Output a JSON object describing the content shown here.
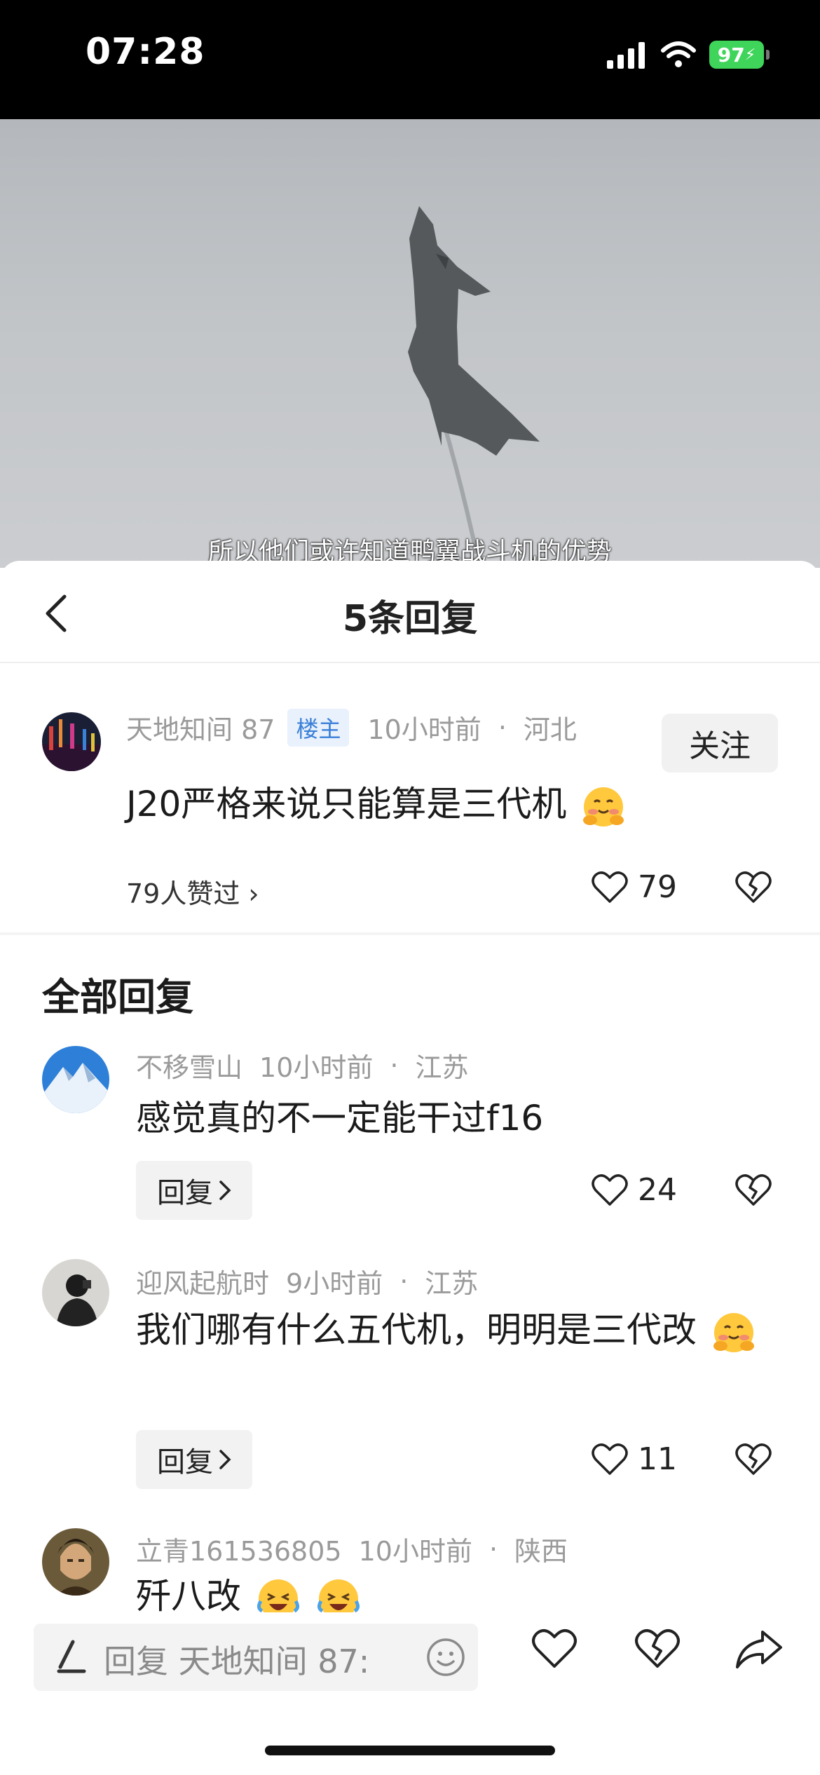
{
  "status_bar": {
    "time": "07:28",
    "battery": "97"
  },
  "video": {
    "subtitle": "所以他们或许知道鸭翼战斗机的优势"
  },
  "sheet": {
    "title": "5条回复",
    "op": {
      "username": "天地知间 87",
      "badge": "楼主",
      "time": "10小时前",
      "location": "河北",
      "follow_label": "关注",
      "text": "J20严格来说只能算是三代机",
      "likers": "79人赞过 ›",
      "like_count": "79"
    },
    "section_title": "全部回复",
    "replies": [
      {
        "username": "不移雪山",
        "time": "10小时前",
        "location": "江苏",
        "text": "感觉真的不一定能干过f16",
        "reply_label": "回复",
        "like_count": "24"
      },
      {
        "username": "迎风起航时",
        "time": "9小时前",
        "location": "江苏",
        "text": "我们哪有什么五代机，明明是三代改",
        "reply_label": "回复",
        "like_count": "11"
      },
      {
        "username": "立青161536805",
        "time": "10小时前",
        "location": "陕西",
        "text": "歼八改"
      }
    ],
    "separator": "·"
  },
  "bottom_bar": {
    "placeholder": "回复 天地知间 87:"
  },
  "colors": {
    "host_badge_bg": "#e8f1fc",
    "host_badge_text": "#3a7fd8",
    "battery": "#3fd45a"
  },
  "icons": [
    "signal-icon",
    "wifi-icon",
    "battery-icon",
    "back-chevron-icon",
    "heart-icon",
    "broken-heart-icon",
    "pen-icon",
    "smiley-icon",
    "share-icon",
    "laughing-crying-emoji",
    "hug-emoji"
  ]
}
